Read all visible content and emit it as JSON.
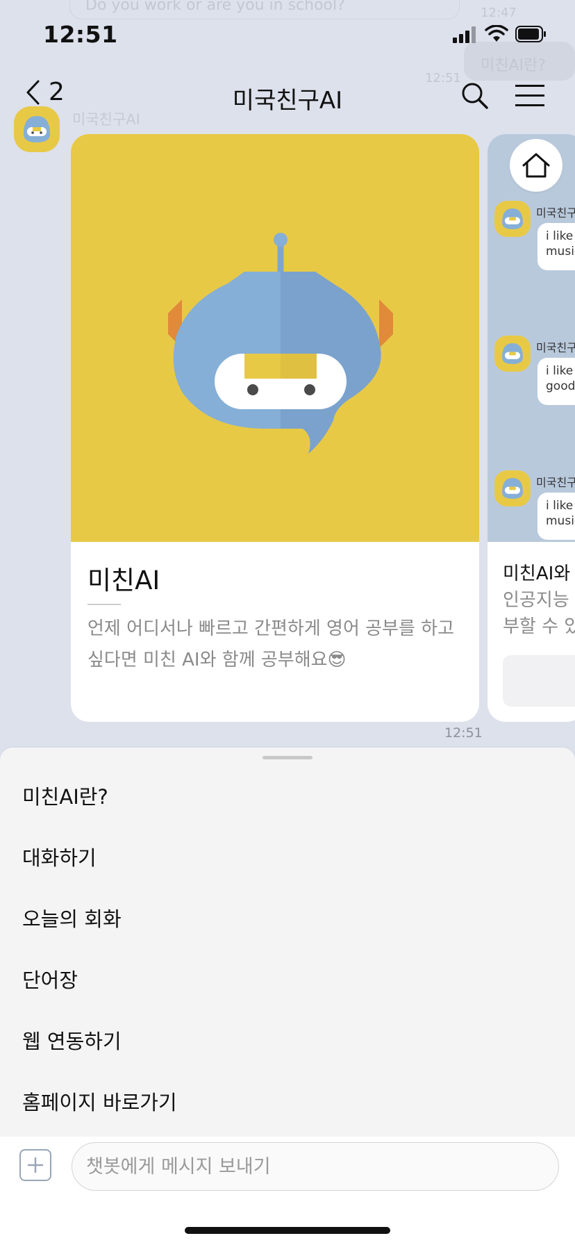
{
  "status_bar": {
    "time": "12:51"
  },
  "faded_background": {
    "message": "Do you work or are you in school?",
    "time_1": "12:47",
    "reply": "미친AI란?",
    "time_2": "12:51",
    "sender": "미국친구AI"
  },
  "header": {
    "back_count": "2",
    "title": "미국친구AI"
  },
  "cards": [
    {
      "title": "미친AI",
      "description": "언제 어디서나 빠르고 간편하게 영어 공부를 하고 싶다면 미친 AI와 함께 공부해요😎"
    },
    {
      "title": "미친AI와 대",
      "description_line1": "인공지능 채",
      "description_line2": "부할 수 있",
      "preview": [
        {
          "name": "미국친구AI",
          "text": "i like a\nmusic"
        },
        {
          "name": "미국친구AI",
          "text": "i like t\ngood"
        },
        {
          "name": "미국친구AI",
          "text": "i like t\nmusic"
        }
      ]
    }
  ],
  "message_time": "12:51",
  "quick_menu": [
    "미친AI란?",
    "대화하기",
    "오늘의 회화",
    "단어장",
    "웹 연동하기",
    "홈페이지 바로가기"
  ],
  "input": {
    "placeholder": "챗봇에게 메시지 보내기"
  },
  "colors": {
    "background": "#dde1ec",
    "card_yellow": "#e8c946",
    "robot_blue": "#85afd6"
  }
}
